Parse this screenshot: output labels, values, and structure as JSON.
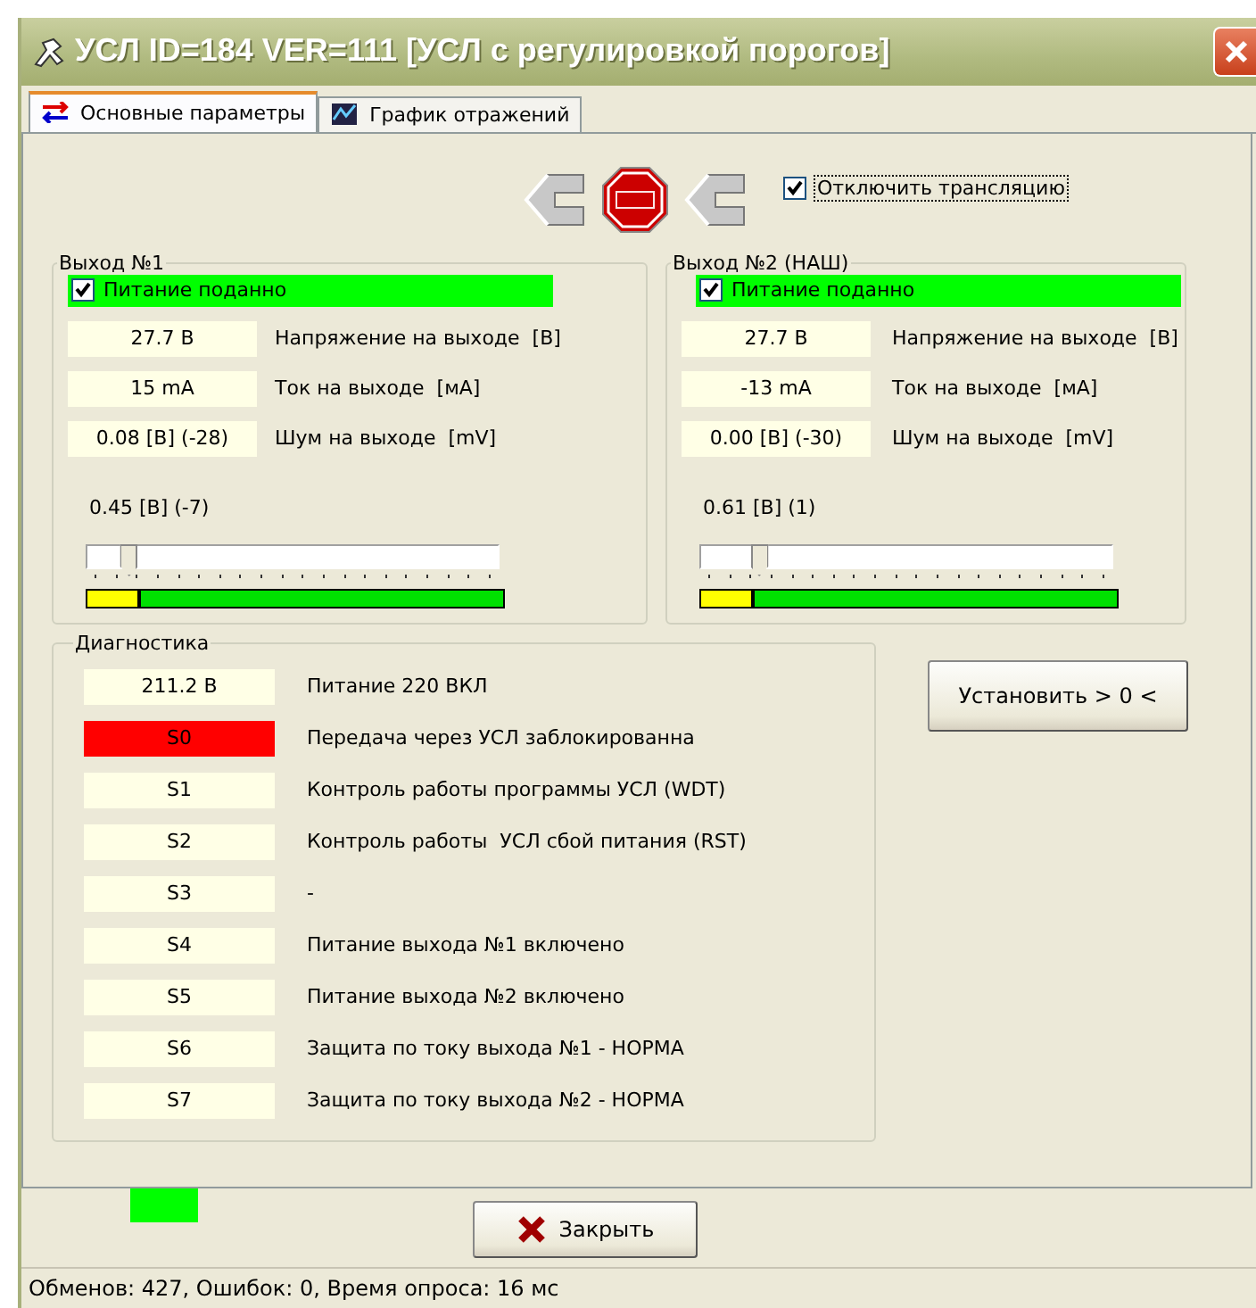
{
  "window": {
    "title": "УСЛ ID=184 VER=111 [УСЛ с регулировкой порогов]"
  },
  "tabs": [
    {
      "label": "Основные параметры",
      "selected": true
    },
    {
      "label": "График отражений",
      "selected": false
    }
  ],
  "toolbar": {
    "disable_relay": {
      "label": "Отключить трансляцию",
      "checked": true
    }
  },
  "outputs": [
    {
      "title": "Выход №1",
      "power": {
        "label": "Питание поданно",
        "checked": true
      },
      "readings": [
        {
          "value": "27.7 В",
          "label": "Напряжение на выходе  [В]"
        },
        {
          "value": "15 mA",
          "label": "Ток на выходе  [мА]"
        },
        {
          "value": "0.08 [В] (-28)",
          "label": "Шум на выходе  [mV]"
        }
      ],
      "threshold": "0.45 [В] (-7)",
      "slider": {
        "level": 0.08
      },
      "meter": {
        "level": 0.13
      }
    },
    {
      "title": "Выход №2 (НАШ)",
      "power": {
        "label": "Питание поданно",
        "checked": true
      },
      "readings": [
        {
          "value": "27.7 В",
          "label": "Напряжение на выходе  [В]"
        },
        {
          "value": "-13 mA",
          "label": "Ток на выходе  [мА]"
        },
        {
          "value": "0.00 [В] (-30)",
          "label": "Шум на выходе  [mV]"
        }
      ],
      "threshold": "0.61 [В] (1)",
      "slider": {
        "level": 0.12
      },
      "meter": {
        "level": 0.13
      }
    }
  ],
  "diagnostics": {
    "title": "Диагностика",
    "rows": [
      {
        "value": "211.2 В",
        "label": "Питание 220 ВКЛ",
        "alarm": false
      },
      {
        "value": "S0",
        "label": "Передача через УСЛ заблокированна",
        "alarm": true
      },
      {
        "value": "S1",
        "label": "Контроль работы программы УСЛ (WDT)",
        "alarm": false
      },
      {
        "value": "S2",
        "label": "Контроль работы  УСЛ сбой питания (RST)",
        "alarm": false
      },
      {
        "value": "S3",
        "label": "-",
        "alarm": false
      },
      {
        "value": "S4",
        "label": "Питание выхода №1 включено",
        "alarm": false
      },
      {
        "value": "S5",
        "label": "Питание выхода №2 включено",
        "alarm": false
      },
      {
        "value": "S6",
        "label": "Защита по току выхода №1 - НОРМА",
        "alarm": false
      },
      {
        "value": "S7",
        "label": "Защита по току выхода №2 - НОРМА",
        "alarm": false
      }
    ]
  },
  "set_zero_button": "Установить > 0 <",
  "close_button": "Закрыть",
  "status_bar": "Обменов: 427, Ошибок: 0, Время опроса: 16 мс"
}
